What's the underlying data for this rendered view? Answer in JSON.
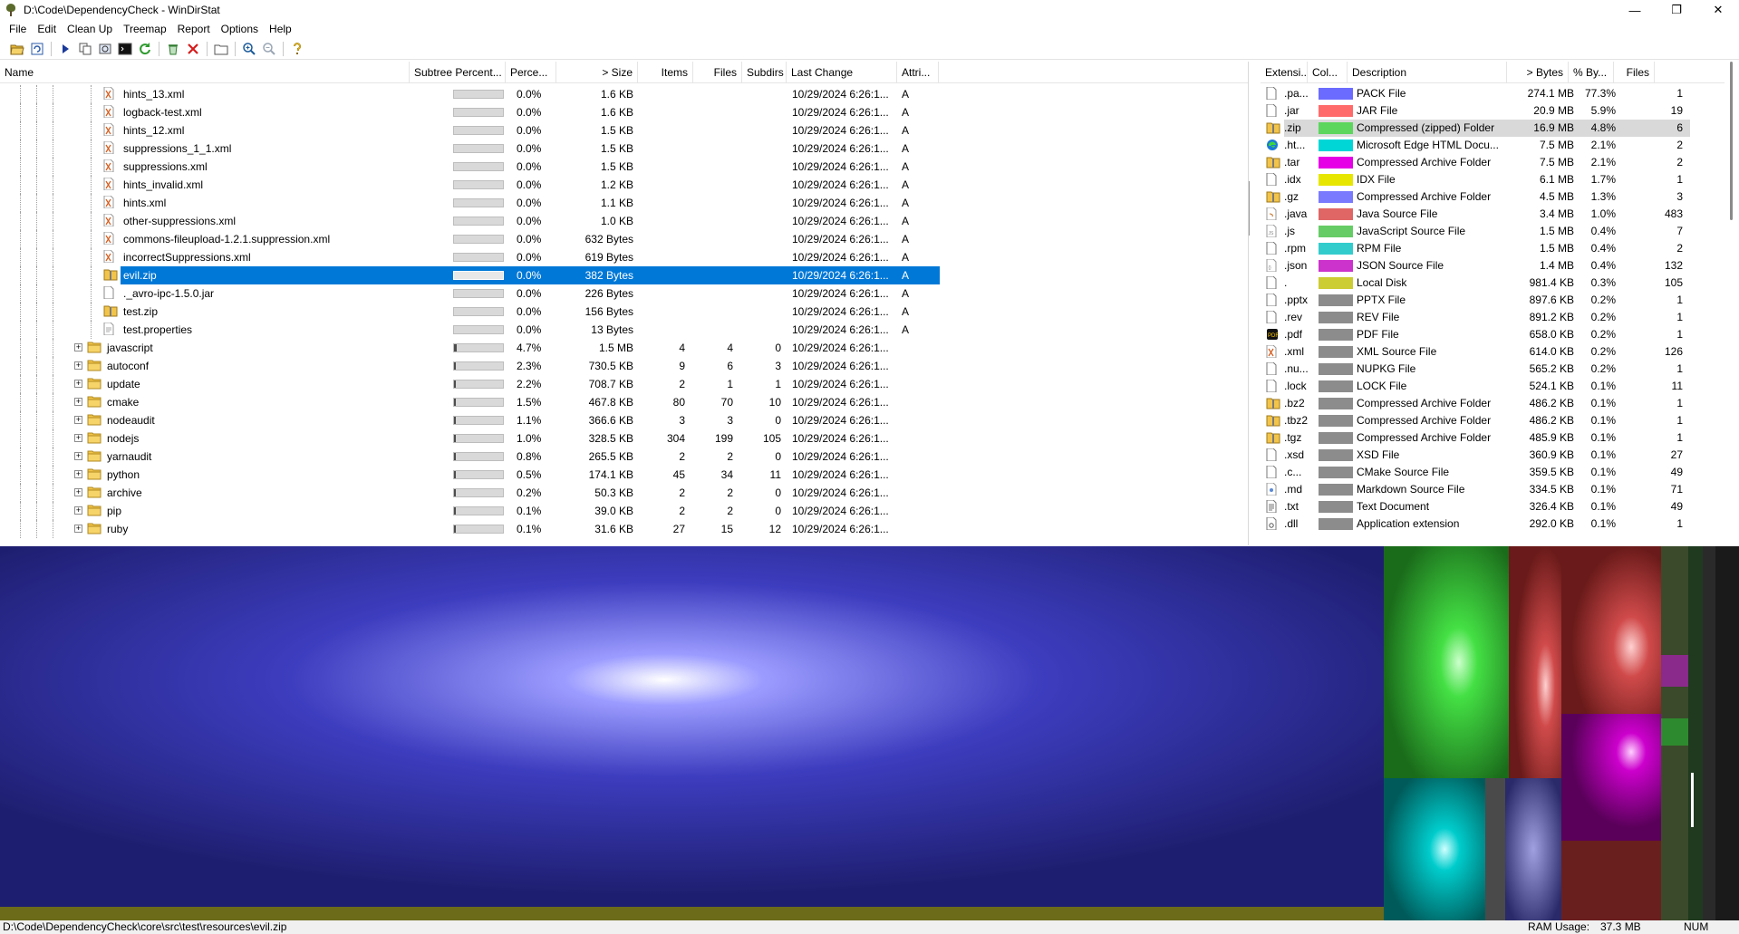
{
  "window": {
    "title": "D:\\Code\\DependencyCheck - WinDirStat",
    "minimize": "—",
    "maximize": "❐",
    "close": "✕"
  },
  "menu": [
    "File",
    "Edit",
    "Clean Up",
    "Treemap",
    "Report",
    "Options",
    "Help"
  ],
  "toolbar": {
    "icons": [
      "open-folder-icon",
      "refresh-icon",
      "play-icon",
      "copy-icon",
      "explorer-icon",
      "command-prompt-icon",
      "refresh-all-icon",
      "recycle-icon",
      "delete-icon",
      "new-folder-icon",
      "zoom-in-icon",
      "zoom-out-icon",
      "help-icon"
    ]
  },
  "tree": {
    "headers": [
      "Name",
      "Subtree Percent...",
      "Perce...",
      "> Size",
      "Items",
      "Files",
      "Subdirs",
      "Last Change",
      "Attri..."
    ],
    "rows": [
      {
        "name": "hints_13.xml",
        "kind": "xml",
        "level": 2,
        "pct": "0.0%",
        "pct_value": 0,
        "size": "1.6 KB",
        "items": "",
        "files": "",
        "subdirs": "",
        "last_change": "10/29/2024  6:26:1...",
        "attr": "A"
      },
      {
        "name": "logback-test.xml",
        "kind": "xml",
        "level": 2,
        "pct": "0.0%",
        "pct_value": 0,
        "size": "1.6 KB",
        "items": "",
        "files": "",
        "subdirs": "",
        "last_change": "10/29/2024  6:26:1...",
        "attr": "A"
      },
      {
        "name": "hints_12.xml",
        "kind": "xml",
        "level": 2,
        "pct": "0.0%",
        "pct_value": 0,
        "size": "1.5 KB",
        "items": "",
        "files": "",
        "subdirs": "",
        "last_change": "10/29/2024  6:26:1...",
        "attr": "A"
      },
      {
        "name": "suppressions_1_1.xml",
        "kind": "xml",
        "level": 2,
        "pct": "0.0%",
        "pct_value": 0,
        "size": "1.5 KB",
        "items": "",
        "files": "",
        "subdirs": "",
        "last_change": "10/29/2024  6:26:1...",
        "attr": "A"
      },
      {
        "name": "suppressions.xml",
        "kind": "xml",
        "level": 2,
        "pct": "0.0%",
        "pct_value": 0,
        "size": "1.5 KB",
        "items": "",
        "files": "",
        "subdirs": "",
        "last_change": "10/29/2024  6:26:1...",
        "attr": "A"
      },
      {
        "name": "hints_invalid.xml",
        "kind": "xml",
        "level": 2,
        "pct": "0.0%",
        "pct_value": 0,
        "size": "1.2 KB",
        "items": "",
        "files": "",
        "subdirs": "",
        "last_change": "10/29/2024  6:26:1...",
        "attr": "A"
      },
      {
        "name": "hints.xml",
        "kind": "xml",
        "level": 2,
        "pct": "0.0%",
        "pct_value": 0,
        "size": "1.1 KB",
        "items": "",
        "files": "",
        "subdirs": "",
        "last_change": "10/29/2024  6:26:1...",
        "attr": "A"
      },
      {
        "name": "other-suppressions.xml",
        "kind": "xml",
        "level": 2,
        "pct": "0.0%",
        "pct_value": 0,
        "size": "1.0 KB",
        "items": "",
        "files": "",
        "subdirs": "",
        "last_change": "10/29/2024  6:26:1...",
        "attr": "A"
      },
      {
        "name": "commons-fileupload-1.2.1.suppression.xml",
        "kind": "xml",
        "level": 2,
        "pct": "0.0%",
        "pct_value": 0,
        "size": "632 Bytes",
        "items": "",
        "files": "",
        "subdirs": "",
        "last_change": "10/29/2024  6:26:1...",
        "attr": "A"
      },
      {
        "name": "incorrectSuppressions.xml",
        "kind": "xml",
        "level": 2,
        "pct": "0.0%",
        "pct_value": 0,
        "size": "619 Bytes",
        "items": "",
        "files": "",
        "subdirs": "",
        "last_change": "10/29/2024  6:26:1...",
        "attr": "A"
      },
      {
        "name": "evil.zip",
        "kind": "zip",
        "level": 2,
        "selected": true,
        "pct": "0.0%",
        "pct_value": 0,
        "size": "382 Bytes",
        "items": "",
        "files": "",
        "subdirs": "",
        "last_change": "10/29/2024  6:26:1...",
        "attr": "A"
      },
      {
        "name": "._avro-ipc-1.5.0.jar",
        "kind": "file",
        "level": 2,
        "pct": "0.0%",
        "pct_value": 0,
        "size": "226 Bytes",
        "items": "",
        "files": "",
        "subdirs": "",
        "last_change": "10/29/2024  6:26:1...",
        "attr": "A"
      },
      {
        "name": "test.zip",
        "kind": "zip",
        "level": 2,
        "pct": "0.0%",
        "pct_value": 0,
        "size": "156 Bytes",
        "items": "",
        "files": "",
        "subdirs": "",
        "last_change": "10/29/2024  6:26:1...",
        "attr": "A"
      },
      {
        "name": "test.properties",
        "kind": "props",
        "level": 2,
        "pct": "0.0%",
        "pct_value": 0,
        "size": "13 Bytes",
        "items": "",
        "files": "",
        "subdirs": "",
        "last_change": "10/29/2024  6:26:1...",
        "attr": "A"
      },
      {
        "name": "javascript",
        "kind": "folder",
        "level": 1,
        "pct": "4.7%",
        "pct_value": 4.7,
        "size": "1.5 MB",
        "items": "4",
        "files": "4",
        "subdirs": "0",
        "last_change": "10/29/2024  6:26:1...",
        "attr": ""
      },
      {
        "name": "autoconf",
        "kind": "folder",
        "level": 1,
        "pct": "2.3%",
        "pct_value": 2.3,
        "size": "730.5 KB",
        "items": "9",
        "files": "6",
        "subdirs": "3",
        "last_change": "10/29/2024  6:26:1...",
        "attr": ""
      },
      {
        "name": "update",
        "kind": "folder",
        "level": 1,
        "pct": "2.2%",
        "pct_value": 2.2,
        "size": "708.7 KB",
        "items": "2",
        "files": "1",
        "subdirs": "1",
        "last_change": "10/29/2024  6:26:1...",
        "attr": ""
      },
      {
        "name": "cmake",
        "kind": "folder",
        "level": 1,
        "pct": "1.5%",
        "pct_value": 1.5,
        "size": "467.8 KB",
        "items": "80",
        "files": "70",
        "subdirs": "10",
        "last_change": "10/29/2024  6:26:1...",
        "attr": ""
      },
      {
        "name": "nodeaudit",
        "kind": "folder",
        "level": 1,
        "pct": "1.1%",
        "pct_value": 1.1,
        "size": "366.6 KB",
        "items": "3",
        "files": "3",
        "subdirs": "0",
        "last_change": "10/29/2024  6:26:1...",
        "attr": ""
      },
      {
        "name": "nodejs",
        "kind": "folder",
        "level": 1,
        "pct": "1.0%",
        "pct_value": 1.0,
        "size": "328.5 KB",
        "items": "304",
        "files": "199",
        "subdirs": "105",
        "last_change": "10/29/2024  6:26:1...",
        "attr": ""
      },
      {
        "name": "yarnaudit",
        "kind": "folder",
        "level": 1,
        "pct": "0.8%",
        "pct_value": 0.8,
        "size": "265.5 KB",
        "items": "2",
        "files": "2",
        "subdirs": "0",
        "last_change": "10/29/2024  6:26:1...",
        "attr": ""
      },
      {
        "name": "python",
        "kind": "folder",
        "level": 1,
        "pct": "0.5%",
        "pct_value": 0.5,
        "size": "174.1 KB",
        "items": "45",
        "files": "34",
        "subdirs": "11",
        "last_change": "10/29/2024  6:26:1...",
        "attr": ""
      },
      {
        "name": "archive",
        "kind": "folder",
        "level": 1,
        "pct": "0.2%",
        "pct_value": 0.2,
        "size": "50.3 KB",
        "items": "2",
        "files": "2",
        "subdirs": "0",
        "last_change": "10/29/2024  6:26:1...",
        "attr": ""
      },
      {
        "name": "pip",
        "kind": "folder",
        "level": 1,
        "pct": "0.1%",
        "pct_value": 0.1,
        "size": "39.0 KB",
        "items": "2",
        "files": "2",
        "subdirs": "0",
        "last_change": "10/29/2024  6:26:1...",
        "attr": ""
      },
      {
        "name": "ruby",
        "kind": "folder",
        "level": 1,
        "pct": "0.1%",
        "pct_value": 0.1,
        "size": "31.6 KB",
        "items": "27",
        "files": "15",
        "subdirs": "12",
        "last_change": "10/29/2024  6:26:1...",
        "attr": ""
      }
    ]
  },
  "extensions": {
    "headers": [
      "Extensi...",
      "Col...",
      "Description",
      "> Bytes",
      "% By...",
      "Files"
    ],
    "rows": [
      {
        "ext": ".pa...",
        "icon": "file",
        "color": "#6b6bff",
        "desc": "PACK File",
        "bytes": "274.1 MB",
        "pct": "77.3%",
        "files": "1"
      },
      {
        "ext": ".jar",
        "icon": "file",
        "color": "#ff6b6b",
        "desc": "JAR File",
        "bytes": "20.9 MB",
        "pct": "5.9%",
        "files": "19"
      },
      {
        "ext": ".zip",
        "icon": "zip",
        "color": "#5cd65c",
        "desc": "Compressed (zipped) Folder",
        "bytes": "16.9 MB",
        "pct": "4.8%",
        "files": "6",
        "selected": true
      },
      {
        "ext": ".ht...",
        "icon": "edge",
        "color": "#00d6d6",
        "desc": "Microsoft Edge HTML Docu...",
        "bytes": "7.5 MB",
        "pct": "2.1%",
        "files": "2"
      },
      {
        "ext": ".tar",
        "icon": "zip",
        "color": "#e600e6",
        "desc": "Compressed Archive Folder",
        "bytes": "7.5 MB",
        "pct": "2.1%",
        "files": "2"
      },
      {
        "ext": ".idx",
        "icon": "file",
        "color": "#e6e600",
        "desc": "IDX File",
        "bytes": "6.1 MB",
        "pct": "1.7%",
        "files": "1"
      },
      {
        "ext": ".gz",
        "icon": "zip",
        "color": "#7a7aff",
        "desc": "Compressed Archive Folder",
        "bytes": "4.5 MB",
        "pct": "1.3%",
        "files": "3"
      },
      {
        "ext": ".java",
        "icon": "java",
        "color": "#e06666",
        "desc": "Java Source File",
        "bytes": "3.4 MB",
        "pct": "1.0%",
        "files": "483"
      },
      {
        "ext": ".js",
        "icon": "js",
        "color": "#66cc66",
        "desc": "JavaScript Source File",
        "bytes": "1.5 MB",
        "pct": "0.4%",
        "files": "7"
      },
      {
        "ext": ".rpm",
        "icon": "file",
        "color": "#33cccc",
        "desc": "RPM File",
        "bytes": "1.5 MB",
        "pct": "0.4%",
        "files": "2"
      },
      {
        "ext": ".json",
        "icon": "json",
        "color": "#cc33cc",
        "desc": "JSON Source File",
        "bytes": "1.4 MB",
        "pct": "0.4%",
        "files": "132"
      },
      {
        "ext": ".",
        "icon": "file",
        "color": "#cccc33",
        "desc": "Local Disk",
        "bytes": "981.4 KB",
        "pct": "0.3%",
        "files": "105"
      },
      {
        "ext": ".pptx",
        "icon": "file",
        "color": "#8c8c8c",
        "desc": "PPTX File",
        "bytes": "897.6 KB",
        "pct": "0.2%",
        "files": "1"
      },
      {
        "ext": ".rev",
        "icon": "file",
        "color": "#8c8c8c",
        "desc": "REV File",
        "bytes": "891.2 KB",
        "pct": "0.2%",
        "files": "1"
      },
      {
        "ext": ".pdf",
        "icon": "pdf",
        "color": "#8c8c8c",
        "desc": "PDF File",
        "bytes": "658.0 KB",
        "pct": "0.2%",
        "files": "1"
      },
      {
        "ext": ".xml",
        "icon": "xml",
        "color": "#8c8c8c",
        "desc": "XML Source File",
        "bytes": "614.0 KB",
        "pct": "0.2%",
        "files": "126"
      },
      {
        "ext": ".nu...",
        "icon": "file",
        "color": "#8c8c8c",
        "desc": "NUPKG File",
        "bytes": "565.2 KB",
        "pct": "0.2%",
        "files": "1"
      },
      {
        "ext": ".lock",
        "icon": "file",
        "color": "#8c8c8c",
        "desc": "LOCK File",
        "bytes": "524.1 KB",
        "pct": "0.1%",
        "files": "11"
      },
      {
        "ext": ".bz2",
        "icon": "zip",
        "color": "#8c8c8c",
        "desc": "Compressed Archive Folder",
        "bytes": "486.2 KB",
        "pct": "0.1%",
        "files": "1"
      },
      {
        "ext": ".tbz2",
        "icon": "zip",
        "color": "#8c8c8c",
        "desc": "Compressed Archive Folder",
        "bytes": "486.2 KB",
        "pct": "0.1%",
        "files": "1"
      },
      {
        "ext": ".tgz",
        "icon": "zip",
        "color": "#8c8c8c",
        "desc": "Compressed Archive Folder",
        "bytes": "485.9 KB",
        "pct": "0.1%",
        "files": "1"
      },
      {
        "ext": ".xsd",
        "icon": "file",
        "color": "#8c8c8c",
        "desc": "XSD File",
        "bytes": "360.9 KB",
        "pct": "0.1%",
        "files": "27"
      },
      {
        "ext": ".c...",
        "icon": "file",
        "color": "#8c8c8c",
        "desc": "CMake Source File",
        "bytes": "359.5 KB",
        "pct": "0.1%",
        "files": "49"
      },
      {
        "ext": ".md",
        "icon": "md",
        "color": "#8c8c8c",
        "desc": "Markdown Source File",
        "bytes": "334.5 KB",
        "pct": "0.1%",
        "files": "71"
      },
      {
        "ext": ".txt",
        "icon": "txt",
        "color": "#8c8c8c",
        "desc": "Text Document",
        "bytes": "326.4 KB",
        "pct": "0.1%",
        "files": "49"
      },
      {
        "ext": ".dll",
        "icon": "dll",
        "color": "#8c8c8c",
        "desc": "Application extension",
        "bytes": "292.0 KB",
        "pct": "0.1%",
        "files": "1"
      }
    ]
  },
  "status": {
    "path": "D:\\Code\\DependencyCheck\\core\\src\\test\\resources\\evil.zip",
    "ram_label": "RAM Usage:",
    "ram_value": "37.3 MB",
    "num_indicator": "NUM"
  }
}
